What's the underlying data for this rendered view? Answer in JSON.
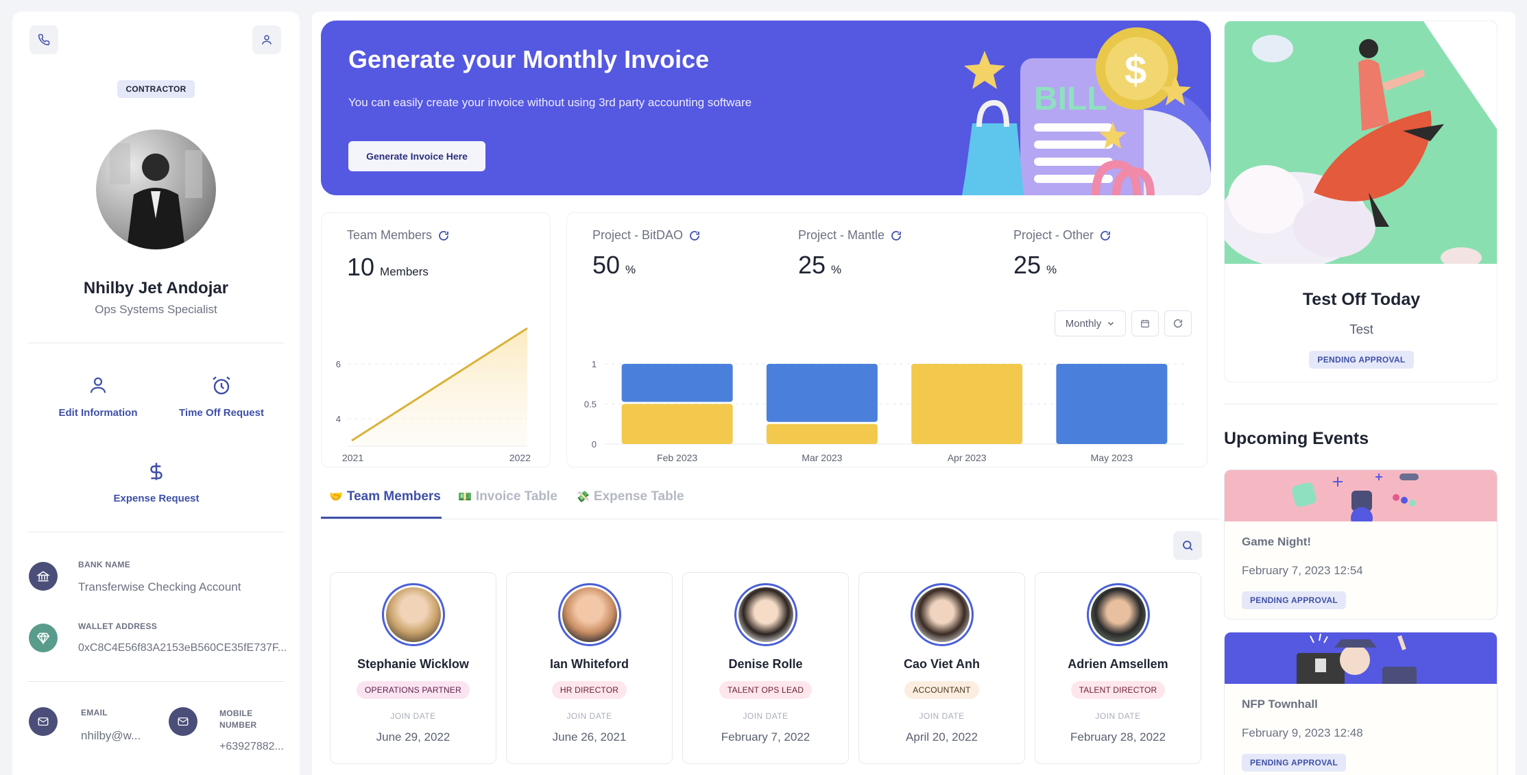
{
  "profile": {
    "type_badge": "CONTRACTOR",
    "name": "Nhilby Jet Andojar",
    "title": "Ops Systems Specialist",
    "actions": {
      "edit": "Edit Information",
      "timeoff": "Time Off Request",
      "expense": "Expense Request"
    },
    "bank_label": "BANK NAME",
    "bank_value": "Transferwise Checking Account",
    "wallet_label": "WALLET ADDRESS",
    "wallet_value": "0xC8C4E56f83A2153eB560CE35fE737F...",
    "email_label": "EMAIL",
    "email_value": "nhilby@w...",
    "mobile_label": "MOBILE NUMBER",
    "mobile_value": "+63927882..."
  },
  "banner": {
    "title": "Generate your Monthly Invoice",
    "subtitle": "You can easily create your invoice without using 3rd party accounting software",
    "button": "Generate Invoice Here",
    "bill_text": "BILL"
  },
  "team_stat": {
    "title": "Team Members",
    "value": "10",
    "unit": "Members"
  },
  "projects": [
    {
      "title": "Project - BitDAO",
      "value": "50",
      "unit": "%"
    },
    {
      "title": "Project - Mantle",
      "value": "25",
      "unit": "%"
    },
    {
      "title": "Project - Other",
      "value": "25",
      "unit": "%"
    }
  ],
  "period_select": "Monthly",
  "chart_data": [
    {
      "type": "area",
      "x": [
        "2021",
        "2022"
      ],
      "y_ticks": [
        "6",
        "4"
      ],
      "series": [
        {
          "values": [
            3.2,
            7.3
          ]
        }
      ],
      "color": "#d9b23a"
    },
    {
      "type": "bar",
      "stacked": true,
      "categories": [
        "Feb 2023",
        "Mar 2023",
        "Apr 2023",
        "May 2023"
      ],
      "y_ticks": [
        "1",
        "0.5",
        "0"
      ],
      "ylim": [
        0,
        1
      ],
      "series": [
        {
          "values": [
            0.5,
            0.25,
            1,
            0
          ],
          "color": "#f2c94c"
        },
        {
          "values": [
            0.5,
            0.75,
            0,
            1
          ],
          "color": "#4a80dc"
        }
      ]
    }
  ],
  "tabs": [
    {
      "icon": "🤝",
      "label": "Team Members"
    },
    {
      "icon": "💵",
      "label": "Invoice Table"
    },
    {
      "icon": "💸",
      "label": "Expense Table"
    }
  ],
  "members": [
    {
      "name": "Stephanie Wicklow",
      "role": "OPERATIONS PARTNER",
      "join_label": "JOIN DATE",
      "date": "June 29, 2022"
    },
    {
      "name": "Ian Whiteford",
      "role": "HR DIRECTOR",
      "join_label": "JOIN DATE",
      "date": "June 26, 2021"
    },
    {
      "name": "Denise Rolle",
      "role": "TALENT OPS LEAD",
      "join_label": "JOIN DATE",
      "date": "February 7, 2022"
    },
    {
      "name": "Cao Viet Anh",
      "role": "ACCOUNTANT",
      "join_label": "JOIN DATE",
      "date": "April 20, 2022"
    },
    {
      "name": "Adrien Amsellem",
      "role": "TALENT DIRECTOR",
      "join_label": "JOIN DATE",
      "date": "February 28, 2022"
    }
  ],
  "timeoff": {
    "title": "Test Off Today",
    "subtitle": "Test",
    "status": "PENDING APPROVAL"
  },
  "events": {
    "heading": "Upcoming Events",
    "items": [
      {
        "title": "Game Night!",
        "date": "February 7, 2023 12:54",
        "status": "PENDING APPROVAL"
      },
      {
        "title": "NFP Townhall",
        "date": "February 9, 2023 12:48",
        "status": "PENDING APPROVAL"
      }
    ]
  }
}
